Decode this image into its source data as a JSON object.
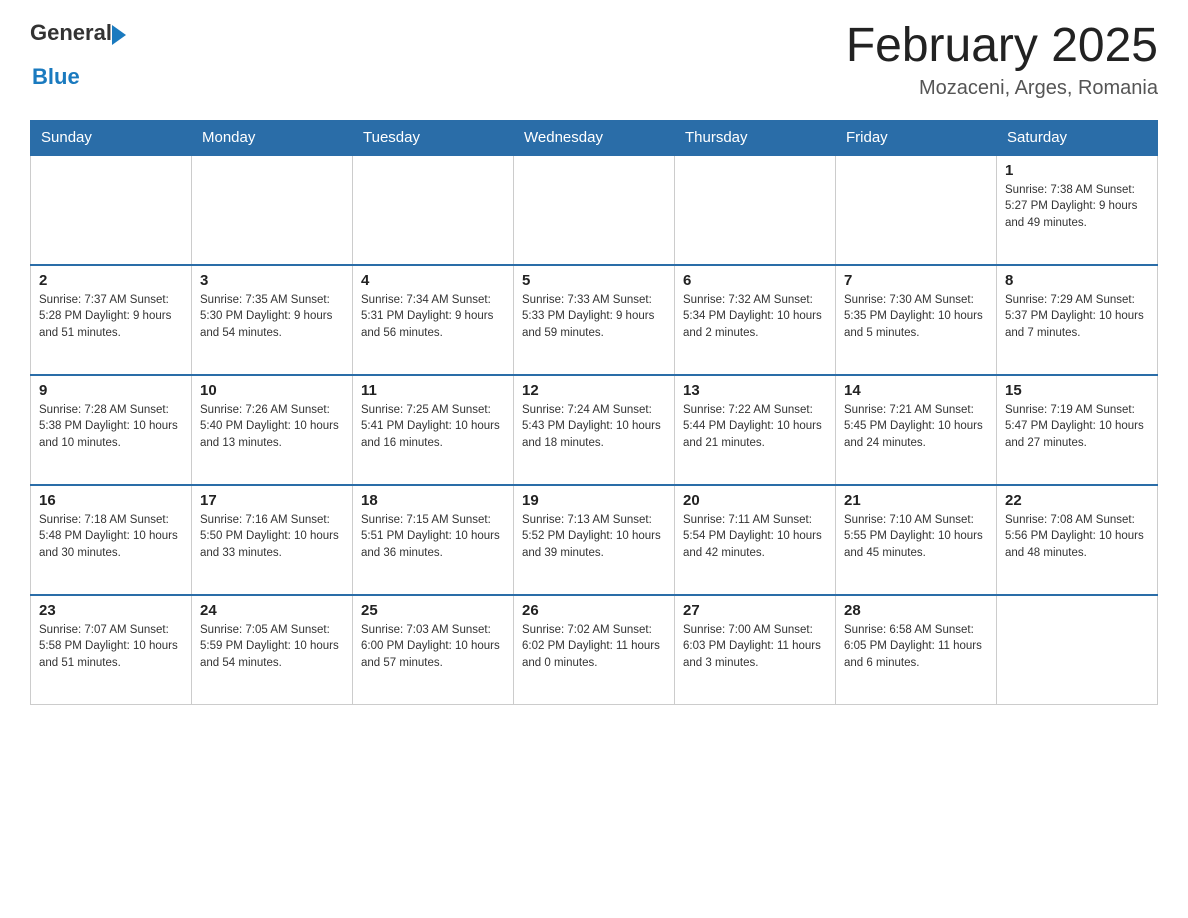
{
  "header": {
    "logo_general": "General",
    "logo_blue": "Blue",
    "month_title": "February 2025",
    "location": "Mozaceni, Arges, Romania"
  },
  "weekdays": [
    "Sunday",
    "Monday",
    "Tuesday",
    "Wednesday",
    "Thursday",
    "Friday",
    "Saturday"
  ],
  "weeks": [
    [
      {
        "day": "",
        "info": ""
      },
      {
        "day": "",
        "info": ""
      },
      {
        "day": "",
        "info": ""
      },
      {
        "day": "",
        "info": ""
      },
      {
        "day": "",
        "info": ""
      },
      {
        "day": "",
        "info": ""
      },
      {
        "day": "1",
        "info": "Sunrise: 7:38 AM\nSunset: 5:27 PM\nDaylight: 9 hours\nand 49 minutes."
      }
    ],
    [
      {
        "day": "2",
        "info": "Sunrise: 7:37 AM\nSunset: 5:28 PM\nDaylight: 9 hours\nand 51 minutes."
      },
      {
        "day": "3",
        "info": "Sunrise: 7:35 AM\nSunset: 5:30 PM\nDaylight: 9 hours\nand 54 minutes."
      },
      {
        "day": "4",
        "info": "Sunrise: 7:34 AM\nSunset: 5:31 PM\nDaylight: 9 hours\nand 56 minutes."
      },
      {
        "day": "5",
        "info": "Sunrise: 7:33 AM\nSunset: 5:33 PM\nDaylight: 9 hours\nand 59 minutes."
      },
      {
        "day": "6",
        "info": "Sunrise: 7:32 AM\nSunset: 5:34 PM\nDaylight: 10 hours\nand 2 minutes."
      },
      {
        "day": "7",
        "info": "Sunrise: 7:30 AM\nSunset: 5:35 PM\nDaylight: 10 hours\nand 5 minutes."
      },
      {
        "day": "8",
        "info": "Sunrise: 7:29 AM\nSunset: 5:37 PM\nDaylight: 10 hours\nand 7 minutes."
      }
    ],
    [
      {
        "day": "9",
        "info": "Sunrise: 7:28 AM\nSunset: 5:38 PM\nDaylight: 10 hours\nand 10 minutes."
      },
      {
        "day": "10",
        "info": "Sunrise: 7:26 AM\nSunset: 5:40 PM\nDaylight: 10 hours\nand 13 minutes."
      },
      {
        "day": "11",
        "info": "Sunrise: 7:25 AM\nSunset: 5:41 PM\nDaylight: 10 hours\nand 16 minutes."
      },
      {
        "day": "12",
        "info": "Sunrise: 7:24 AM\nSunset: 5:43 PM\nDaylight: 10 hours\nand 18 minutes."
      },
      {
        "day": "13",
        "info": "Sunrise: 7:22 AM\nSunset: 5:44 PM\nDaylight: 10 hours\nand 21 minutes."
      },
      {
        "day": "14",
        "info": "Sunrise: 7:21 AM\nSunset: 5:45 PM\nDaylight: 10 hours\nand 24 minutes."
      },
      {
        "day": "15",
        "info": "Sunrise: 7:19 AM\nSunset: 5:47 PM\nDaylight: 10 hours\nand 27 minutes."
      }
    ],
    [
      {
        "day": "16",
        "info": "Sunrise: 7:18 AM\nSunset: 5:48 PM\nDaylight: 10 hours\nand 30 minutes."
      },
      {
        "day": "17",
        "info": "Sunrise: 7:16 AM\nSunset: 5:50 PM\nDaylight: 10 hours\nand 33 minutes."
      },
      {
        "day": "18",
        "info": "Sunrise: 7:15 AM\nSunset: 5:51 PM\nDaylight: 10 hours\nand 36 minutes."
      },
      {
        "day": "19",
        "info": "Sunrise: 7:13 AM\nSunset: 5:52 PM\nDaylight: 10 hours\nand 39 minutes."
      },
      {
        "day": "20",
        "info": "Sunrise: 7:11 AM\nSunset: 5:54 PM\nDaylight: 10 hours\nand 42 minutes."
      },
      {
        "day": "21",
        "info": "Sunrise: 7:10 AM\nSunset: 5:55 PM\nDaylight: 10 hours\nand 45 minutes."
      },
      {
        "day": "22",
        "info": "Sunrise: 7:08 AM\nSunset: 5:56 PM\nDaylight: 10 hours\nand 48 minutes."
      }
    ],
    [
      {
        "day": "23",
        "info": "Sunrise: 7:07 AM\nSunset: 5:58 PM\nDaylight: 10 hours\nand 51 minutes."
      },
      {
        "day": "24",
        "info": "Sunrise: 7:05 AM\nSunset: 5:59 PM\nDaylight: 10 hours\nand 54 minutes."
      },
      {
        "day": "25",
        "info": "Sunrise: 7:03 AM\nSunset: 6:00 PM\nDaylight: 10 hours\nand 57 minutes."
      },
      {
        "day": "26",
        "info": "Sunrise: 7:02 AM\nSunset: 6:02 PM\nDaylight: 11 hours\nand 0 minutes."
      },
      {
        "day": "27",
        "info": "Sunrise: 7:00 AM\nSunset: 6:03 PM\nDaylight: 11 hours\nand 3 minutes."
      },
      {
        "day": "28",
        "info": "Sunrise: 6:58 AM\nSunset: 6:05 PM\nDaylight: 11 hours\nand 6 minutes."
      },
      {
        "day": "",
        "info": ""
      }
    ]
  ]
}
